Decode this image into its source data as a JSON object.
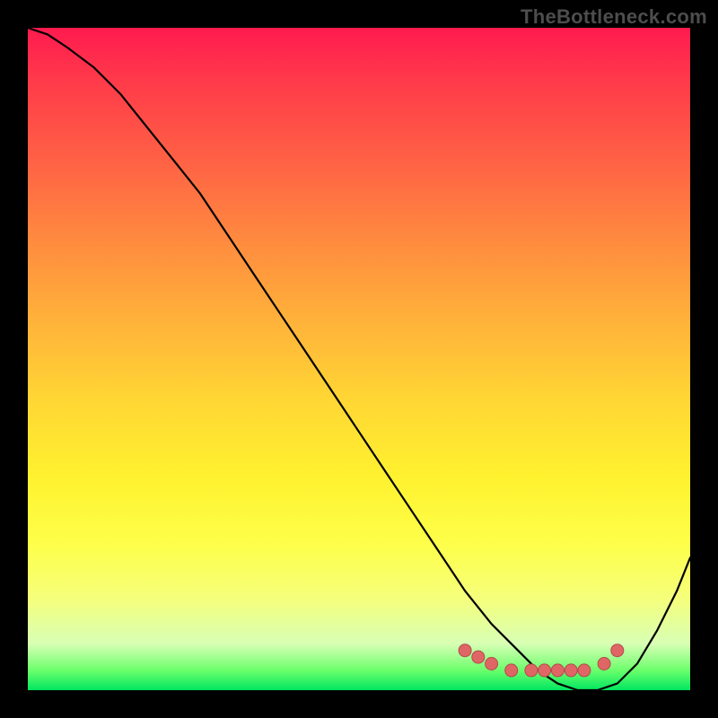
{
  "watermark": "TheBottleneck.com",
  "colors": {
    "background": "#000000",
    "gradient_top": "#ff1a4f",
    "gradient_bottom": "#00e660",
    "curve": "#000000",
    "dots": "#e06666"
  },
  "chart_data": {
    "type": "line",
    "title": "",
    "xlabel": "",
    "ylabel": "",
    "xlim": [
      0,
      100
    ],
    "ylim": [
      0,
      100
    ],
    "series": [
      {
        "name": "bottleneck-curve",
        "x": [
          0,
          3,
          6,
          10,
          14,
          18,
          22,
          26,
          30,
          34,
          38,
          42,
          46,
          50,
          54,
          58,
          62,
          66,
          70,
          74,
          77,
          80,
          83,
          86,
          89,
          92,
          95,
          98,
          100
        ],
        "y": [
          100,
          99,
          97,
          94,
          90,
          85,
          80,
          75,
          69,
          63,
          57,
          51,
          45,
          39,
          33,
          27,
          21,
          15,
          10,
          6,
          3,
          1,
          0,
          0,
          1,
          4,
          9,
          15,
          20
        ]
      }
    ],
    "highlight_points": {
      "name": "optimal-range-dots",
      "x": [
        66,
        68,
        70,
        73,
        76,
        78,
        80,
        82,
        84,
        87,
        89
      ],
      "y": [
        6,
        5,
        4,
        3,
        3,
        3,
        3,
        3,
        3,
        4,
        6
      ]
    }
  }
}
